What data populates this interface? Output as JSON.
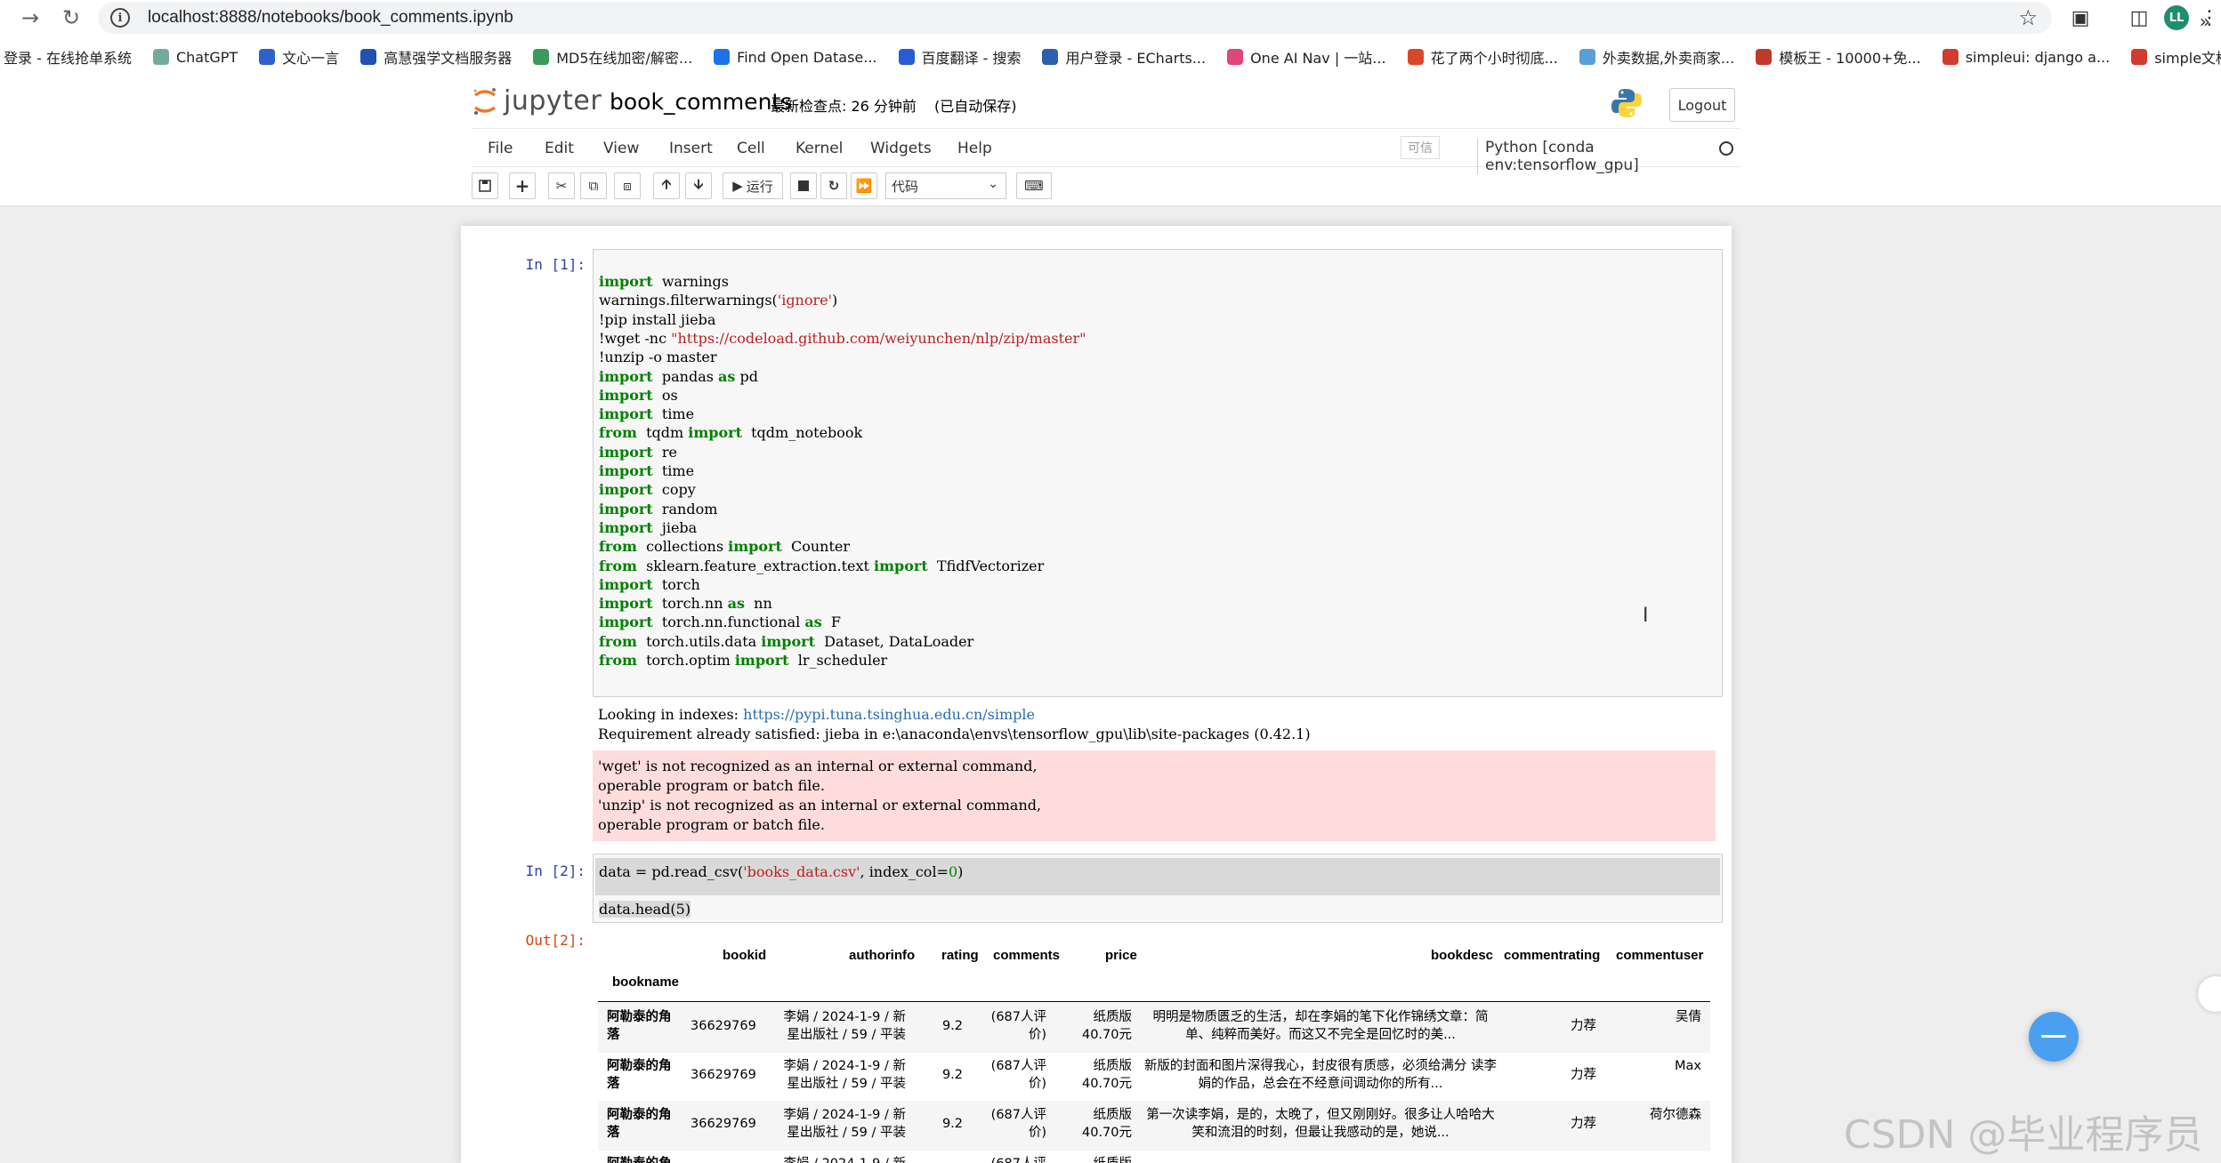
{
  "browser": {
    "url": "localhost:8888/notebooks/book_comments.ipynb",
    "profile_initials": "LL"
  },
  "bookmarks": [
    {
      "label": "登录 - 在线抢单系统",
      "color": ""
    },
    {
      "label": "ChatGPT",
      "color": "#74aa9c"
    },
    {
      "label": "文心一言",
      "color": "#3060d0"
    },
    {
      "label": "高慧强学文档服务器",
      "color": "#2050b0"
    },
    {
      "label": "MD5在线加密/解密...",
      "color": "#3a9a5a"
    },
    {
      "label": "Find Open Datase...",
      "color": "#1a73e8"
    },
    {
      "label": "百度翻译 - 搜索",
      "color": "#2a5bd7"
    },
    {
      "label": "用户登录 - ECharts...",
      "color": "#2b5fb0"
    },
    {
      "label": "One AI Nav | 一站...",
      "color": "#e0457b"
    },
    {
      "label": "花了两个小时彻底...",
      "color": "#d9472b"
    },
    {
      "label": "外卖数据,外卖商家...",
      "color": "#5aa0d8"
    },
    {
      "label": "模板王 - 10000+免...",
      "color": "#c0392b"
    },
    {
      "label": "simpleui: django a...",
      "color": "#d23b2f"
    },
    {
      "label": "simple文档",
      "color": "#d23b2f"
    }
  ],
  "header": {
    "logo_text": "jupyter",
    "notebook_title": "book_comments",
    "checkpoint": "最新检查点: 26 分钟前",
    "autosave": "(已自动保存)",
    "logout_label": "Logout"
  },
  "menu": {
    "items": [
      "File",
      "Edit",
      "View",
      "Insert",
      "Cell",
      "Kernel",
      "Widgets",
      "Help"
    ],
    "trusted": "可信",
    "kernel": "Python [conda env:tensorflow_gpu]"
  },
  "toolbar": {
    "run_label": "运行",
    "cell_type": "代码"
  },
  "cells": {
    "cell1_prompt": "In  [1]:",
    "cell2_prompt": "In  [2]:",
    "out2_prompt": "Out[2]:",
    "cell2_line1": "data = pd.read_csv(",
    "cell2_str": "'books_data.csv'",
    "cell2_line1b": ", index_col=",
    "cell2_num": "0",
    "cell2_line1c": ")",
    "cell2_line2": "data.head(5)"
  },
  "cell1_code": [
    [
      [
        "kw",
        "import"
      ],
      [
        "",
        "  warnings"
      ]
    ],
    [
      [
        "",
        "warnings.filterwarnings("
      ],
      [
        "str",
        "'ignore'"
      ],
      [
        "",
        ")"
      ]
    ],
    [
      [
        "",
        "!pip install jieba"
      ]
    ],
    [
      [
        "",
        "!wget -nc "
      ],
      [
        "str",
        "\"https://codeload.github.com/weiyunchen/nlp/zip/master\""
      ]
    ],
    [
      [
        "",
        "!unzip -o master"
      ]
    ],
    [
      [
        "kw",
        "import"
      ],
      [
        "",
        "  pandas "
      ],
      [
        "kw",
        "as"
      ],
      [
        "",
        " pd"
      ]
    ],
    [
      [
        "kw",
        "import"
      ],
      [
        "",
        "  os"
      ]
    ],
    [
      [
        "kw",
        "import"
      ],
      [
        "",
        "  time"
      ]
    ],
    [
      [
        "kw",
        "from"
      ],
      [
        "",
        "  tqdm "
      ],
      [
        "kw",
        "import"
      ],
      [
        "",
        "  tqdm_notebook"
      ]
    ],
    [
      [
        "kw",
        "import"
      ],
      [
        "",
        "  re"
      ]
    ],
    [
      [
        "kw",
        "import"
      ],
      [
        "",
        "  time"
      ]
    ],
    [
      [
        "kw",
        "import"
      ],
      [
        "",
        "  copy"
      ]
    ],
    [
      [
        "kw",
        "import"
      ],
      [
        "",
        "  random"
      ]
    ],
    [
      [
        "kw",
        "import"
      ],
      [
        "",
        "  jieba"
      ]
    ],
    [
      [
        "kw",
        "from"
      ],
      [
        "",
        "  collections "
      ],
      [
        "kw",
        "import"
      ],
      [
        "",
        "  Counter"
      ]
    ],
    [
      [
        "kw",
        "from"
      ],
      [
        "",
        "  sklearn.feature_extraction.text "
      ],
      [
        "kw",
        "import"
      ],
      [
        "",
        "  TfidfVectorizer"
      ]
    ],
    [
      [
        "kw",
        "import"
      ],
      [
        "",
        "  torch"
      ]
    ],
    [
      [
        "kw",
        "import"
      ],
      [
        "",
        "  torch.nn "
      ],
      [
        "kw",
        "as"
      ],
      [
        "",
        "  nn"
      ]
    ],
    [
      [
        "kw",
        "import"
      ],
      [
        "",
        "  torch.nn.functional "
      ],
      [
        "kw",
        "as"
      ],
      [
        "",
        "  F"
      ]
    ],
    [
      [
        "kw",
        "from"
      ],
      [
        "",
        "  torch.utils.data "
      ],
      [
        "kw",
        "import"
      ],
      [
        "",
        "  Dataset, DataLoader"
      ]
    ],
    [
      [
        "kw",
        "from"
      ],
      [
        "",
        "  torch.optim "
      ],
      [
        "kw",
        "import"
      ],
      [
        "",
        "  lr_scheduler"
      ]
    ]
  ],
  "cell1_output": {
    "stdout1_prefix": "Looking in indexes: ",
    "stdout1_link": "https://pypi.tuna.tsinghua.edu.cn/simple",
    "stdout2": "Requirement already satisfied: jieba in e:\\anaconda\\envs\\tensorflow_gpu\\lib\\site-packages (0.42.1)",
    "stderr": [
      "'wget' is not recognized as an internal or external command,",
      "operable program or batch file.",
      "'unzip' is not recognized as an internal or external command,",
      "operable program or batch file."
    ]
  },
  "dataframe": {
    "columns": [
      "bookid",
      "authorinfo",
      "rating",
      "comments",
      "price",
      "bookdesc",
      "commentrating",
      "commentuser"
    ],
    "index_name": "bookname",
    "rows": [
      {
        "bookname": "阿勒泰的角落",
        "bookid": "36629769",
        "authorinfo": "李娟 / 2024-1-9 / 新星出版社 / 59 / 平装",
        "rating": "9.2",
        "comments": "(687人评价)",
        "price": "纸质版 40.70元",
        "bookdesc": "明明是物质匮乏的生活，却在李娟的笔下化作锦绣文章：简单、纯粹而美好。而这又不完全是回忆时的美...",
        "commentrating": "力荐",
        "commentuser": "吴倩"
      },
      {
        "bookname": "阿勒泰的角落",
        "bookid": "36629769",
        "authorinfo": "李娟 / 2024-1-9 / 新星出版社 / 59 / 平装",
        "rating": "9.2",
        "comments": "(687人评价)",
        "price": "纸质版 40.70元",
        "bookdesc": "新版的封面和图片深得我心，封皮很有质感，必须给满分 读李娟的作品，总会在不经意间调动你的所有...",
        "commentrating": "力荐",
        "commentuser": "Max"
      },
      {
        "bookname": "阿勒泰的角落",
        "bookid": "36629769",
        "authorinfo": "李娟 / 2024-1-9 / 新星出版社 / 59 / 平装",
        "rating": "9.2",
        "comments": "(687人评价)",
        "price": "纸质版 40.70元",
        "bookdesc": "第一次读李娟，是的，太晚了，但又刚刚好。很多让人哈哈大笑和流泪的时刻，但最让我感动的是，她说...",
        "commentrating": "力荐",
        "commentuser": "荷尔德森"
      },
      {
        "bookname": "阿勒泰的角",
        "bookid": "",
        "authorinfo": "李娟 / 2024-1-9 / 新星出",
        "rating": "",
        "comments": "(687人评",
        "price": "纸质版",
        "bookdesc": "",
        "commentrating": "",
        "commentuser": ""
      }
    ]
  },
  "watermark": "CSDN @毕业程序员"
}
